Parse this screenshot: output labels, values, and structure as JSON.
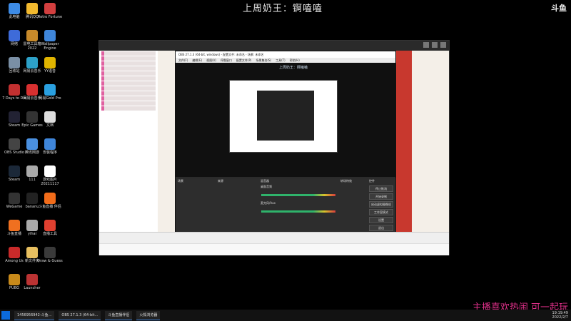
{
  "overlay": {
    "title": "上周奶王：锕嗑嗑",
    "logo": "斗鱼",
    "bottom_banner": "主播喜欢热闹 可一起玩"
  },
  "desktop_icons": [
    {
      "label": "此电脑",
      "color": "#3d8be6"
    },
    {
      "label": "腾讯QQ",
      "color": "#f2b92e"
    },
    {
      "label": "Retro Fortune",
      "color": "#d23f3f"
    },
    {
      "label": "网络",
      "color": "#3e6bd9"
    },
    {
      "label": "雷电工具箱 2022",
      "color": "#c88a2a"
    },
    {
      "label": "Wallpaper Engine",
      "color": "#3f86da"
    },
    {
      "label": "回收站",
      "color": "#7a8fa5"
    },
    {
      "label": "网易云音乐",
      "color": "#2da1c8"
    },
    {
      "label": "YY语音",
      "color": "#e0b400"
    },
    {
      "label": "7 Days to Die",
      "color": "#c23030"
    },
    {
      "label": "网易云音乐",
      "color": "#d83030"
    },
    {
      "label": "网易Gold Pro",
      "color": "#2aa0e0"
    },
    {
      "label": "Steam",
      "color": "#223"
    },
    {
      "label": "Epic Games",
      "color": "#333"
    },
    {
      "label": "文档",
      "color": "#ddd"
    },
    {
      "label": "OBS Studio",
      "color": "#444"
    },
    {
      "label": "腾讯网游",
      "color": "#4a90e0"
    },
    {
      "label": "安装程序",
      "color": "#3f86da"
    },
    {
      "label": "Steam",
      "color": "#1b2838"
    },
    {
      "label": "111",
      "color": "#aaa"
    },
    {
      "label": "游戏图片 20211117",
      "color": "#fff"
    },
    {
      "label": "WeGame",
      "color": "#333"
    },
    {
      "label": "bananu",
      "color": "#222"
    },
    {
      "label": "斗鱼直播 伴侣",
      "color": "#f26c1a"
    },
    {
      "label": "斗鱼直播",
      "color": "#f07020"
    },
    {
      "label": "yihai",
      "color": "#aaa"
    },
    {
      "label": "直播工具",
      "color": "#e04030"
    },
    {
      "label": "Among Us",
      "color": "#c82a2a"
    },
    {
      "label": "新文件夹",
      "color": "#e8c060"
    },
    {
      "label": "Draw & Guess",
      "color": "#3a3a3a"
    },
    {
      "label": "PUBG",
      "color": "#c88a1a"
    },
    {
      "label": "Launcher",
      "color": "#bb3333"
    }
  ],
  "browser_window": {
    "obs_title": "OBS 27.1.3 (64-bit, windows) - 配置文件: 未命名 - 场景: 未命名",
    "obs_menu": [
      "文件(F)",
      "编辑(E)",
      "视图(V)",
      "停靠窗口",
      "配置文件(P)",
      "场景集合(S)",
      "工具(T)",
      "帮助(H)"
    ],
    "preview_title": "上周奶王：锕嗑嗑",
    "docks": {
      "scenes": "场景",
      "sources": "来源",
      "mixer": "混音器",
      "transitions": "转场特效",
      "controls": "控件"
    },
    "mixer_channels": [
      "桌面音频",
      "麦克风/Aux"
    ],
    "controls_buttons": [
      "停止推流",
      "开始录制",
      "启动虚拟摄像机",
      "工作室模式",
      "设置",
      "退出"
    ],
    "status": "LIVE: 00:00:00  REC: 00:00:00  CPU: 3.3%  30.00 fps"
  },
  "taskbar": {
    "tasks": [
      "1456956942-斗鱼...",
      "OBS 27.1.3 (64-bit...",
      "斗鱼直播伴侣",
      "火狐浏览器"
    ],
    "clock_time": "19:19:49",
    "clock_date": "2022/2/7"
  }
}
